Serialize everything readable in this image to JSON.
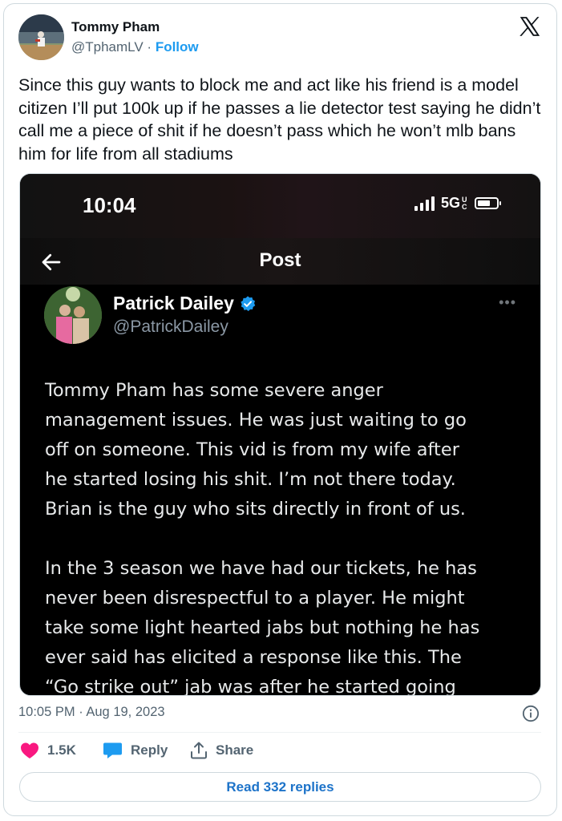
{
  "author": {
    "name": "Tommy Pham",
    "handle": "@TphamLV",
    "separator": " · ",
    "follow_label": "Follow"
  },
  "tweet_text": "Since this guy wants to block me and act like his friend is a model citizen I’ll put 100k up if he passes a lie detector test saying he didn’t call me a piece of shit if he doesn’t pass which he won’t mlb bans him for life from all stadiums",
  "screenshot": {
    "clock": "10:04",
    "network": "5G",
    "network_suffix": "UC",
    "post_title": "Post",
    "inner_author": {
      "name": "Patrick Dailey",
      "handle": "@PatrickDailey",
      "more": "•••"
    },
    "paragraphs": [
      "Tommy Pham has some severe anger\nmanagement issues. He was just waiting to go\noff on someone. This vid is from my wife after\nhe started losing his shit. I’m not there today.\nBrian is the guy who sits directly in front of us.",
      "In the 3 season we have had our tickets, he has\nnever been disrespectful to a player. He might\ntake some light hearted jabs but nothing he has\never said has elicited a response like this. The\n“Go strike out” jab was after he started going"
    ]
  },
  "timestamp": "10:05 PM · Aug 19, 2023",
  "actions": {
    "likes": "1.5K",
    "reply": "Reply",
    "share": "Share"
  },
  "read_replies": "Read 332 replies",
  "colors": {
    "link": "#1d9bf0",
    "like": "#f91880",
    "reply_icon": "#1d9bf0",
    "verified": "#1d9bf0"
  }
}
